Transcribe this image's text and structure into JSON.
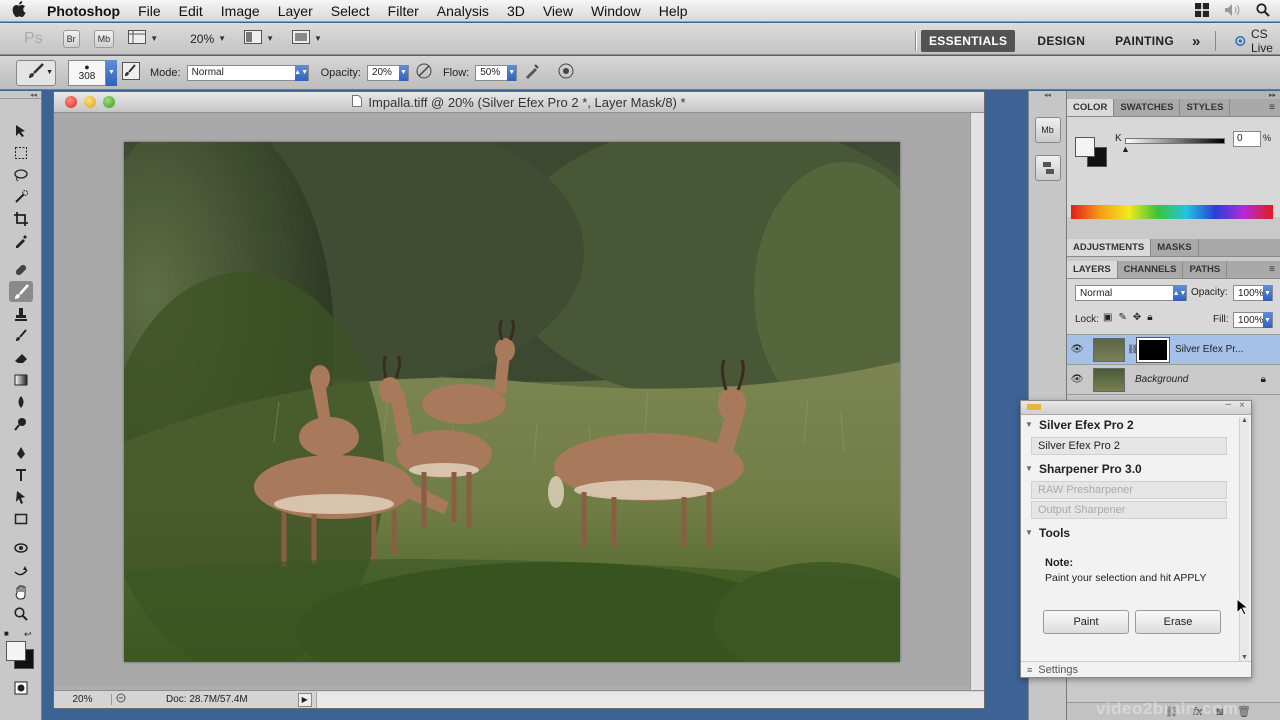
{
  "menubar": {
    "app": "Photoshop",
    "items": [
      "File",
      "Edit",
      "Image",
      "Layer",
      "Select",
      "Filter",
      "Analysis",
      "3D",
      "View",
      "Window",
      "Help"
    ]
  },
  "appbar": {
    "logo": "Ps",
    "bridge": "Br",
    "minibridge": "Mb",
    "zoom": "20%",
    "workspaces": [
      "ESSENTIALS",
      "DESIGN",
      "PAINTING"
    ],
    "more": "»",
    "cslive": "CS Live"
  },
  "optbar": {
    "brush_size": "308",
    "mode_label": "Mode:",
    "mode_value": "Normal",
    "opacity_label": "Opacity:",
    "opacity_value": "20%",
    "flow_label": "Flow:",
    "flow_value": "50%"
  },
  "document": {
    "title": "Impalla.tiff @ 20% (Silver Efex Pro 2 *, Layer Mask/8) *",
    "zoom": "20%",
    "doc_size": "Doc: 28.7M/57.4M"
  },
  "color_panel": {
    "tabs": [
      "COLOR",
      "SWATCHES",
      "STYLES"
    ],
    "channel": "K",
    "value": "0",
    "unit": "%"
  },
  "adjust_panel": {
    "tabs": [
      "ADJUSTMENTS",
      "MASKS"
    ]
  },
  "layers_panel": {
    "tabs": [
      "LAYERS",
      "CHANNELS",
      "PATHS"
    ],
    "blend": "Normal",
    "opacity_label": "Opacity:",
    "opacity": "100%",
    "lock_label": "Lock:",
    "fill_label": "Fill:",
    "fill": "100%",
    "layers": [
      {
        "name": "Silver Efex Pr...",
        "selected": true
      },
      {
        "name": "Background",
        "selected": false
      }
    ]
  },
  "efex_panel": {
    "section1": "Silver Efex Pro 2",
    "item1": "Silver Efex Pro 2",
    "section2": "Sharpener Pro 3.0",
    "item2": "RAW Presharpener",
    "item3": "Output Sharpener",
    "section3": "Tools",
    "note_title": "Note:",
    "note_text": "Paint your selection and hit APPLY",
    "paint_btn": "Paint",
    "erase_btn": "Erase",
    "settings": "Settings"
  },
  "watermark": "video2brain.com",
  "colors": {
    "desktop": "#3d6394",
    "selection": "#a6c1e8",
    "accent_blue": "#2f61b8"
  }
}
